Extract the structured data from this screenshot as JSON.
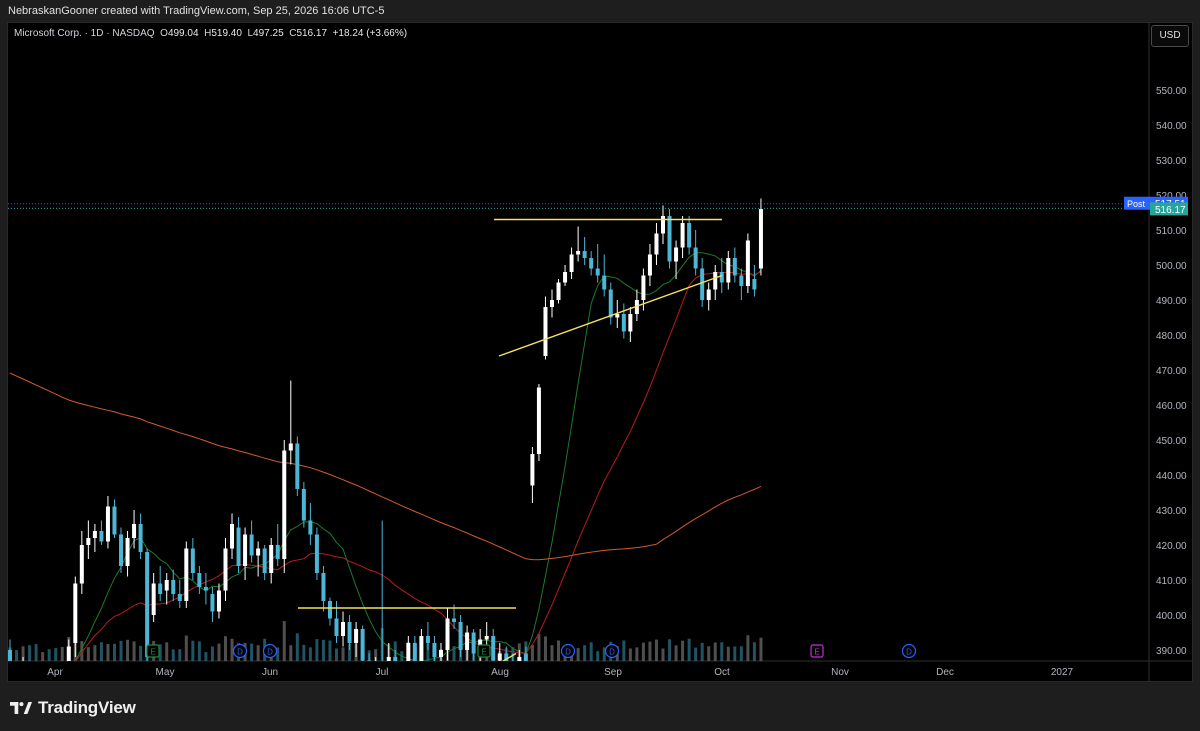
{
  "header": {
    "attribution": "NebraskanGooner created with TradingView.com, Sep 25, 2026 16:06 UTC-5"
  },
  "legend": {
    "symbol": "Microsoft Corp. · 1D · NASDAQ",
    "o_label": "O",
    "o_value": "499.04",
    "h_label": "H",
    "h_value": "519.40",
    "l_label": "L",
    "l_value": "497.25",
    "c_label": "C",
    "c_value": "516.17",
    "change": "+18.24 (+3.66%)"
  },
  "currency_button": "USD",
  "footer": {
    "brand": "TradingView"
  },
  "colors": {
    "up": "#ffffff",
    "down": "#4db6d6",
    "sma_short": "#1b7a2e",
    "sma_mid": "#b71c1c",
    "sma_long": "#d25b2c",
    "trendline": "#f5e15a",
    "post_badge": "#2962ff",
    "last_badge": "#26a69a"
  },
  "chart_data": {
    "type": "candlestick",
    "y_axis": {
      "ylim": [
        381,
        560
      ],
      "ticks": [
        "550.00",
        "540.00",
        "530.00",
        "520.00",
        "510.00",
        "500.00",
        "490.00",
        "480.00",
        "470.00",
        "460.00",
        "450.00",
        "440.00",
        "430.00",
        "420.00",
        "410.00",
        "400.00",
        "390.00"
      ]
    },
    "x_axis": {
      "ticks": [
        "Apr",
        "May",
        "Jun",
        "Jul",
        "Aug",
        "Sep",
        "Oct",
        "Nov",
        "Dec",
        "2027"
      ]
    },
    "price_badges": [
      {
        "label": "Post",
        "value": "517.51"
      },
      {
        "label": "",
        "value": "516.17"
      }
    ],
    "event_markers": [
      {
        "type": "E",
        "near": "May"
      },
      {
        "type": "D",
        "near": "May"
      },
      {
        "type": "D",
        "near": "Jun"
      },
      {
        "type": "E",
        "near": "Aug"
      },
      {
        "type": "D",
        "near": "Aug"
      },
      {
        "type": "D",
        "near": "Sep"
      },
      {
        "type": "E",
        "near": "Nov"
      },
      {
        "type": "D",
        "near": "Nov"
      }
    ],
    "ohlc": [
      [
        390,
        393,
        382,
        384
      ],
      [
        384,
        386,
        381,
        383
      ],
      [
        383,
        388,
        381,
        386
      ],
      [
        386,
        387,
        383,
        384
      ],
      [
        384,
        385,
        381,
        383
      ],
      [
        384,
        386,
        382,
        385
      ],
      [
        385,
        386,
        382,
        383
      ],
      [
        383,
        384,
        381,
        382
      ],
      [
        382,
        383,
        381,
        382
      ],
      [
        382,
        393,
        381,
        391
      ],
      [
        392,
        411,
        388,
        409
      ],
      [
        409,
        424,
        406,
        420
      ],
      [
        420,
        427,
        416,
        422
      ],
      [
        422,
        426,
        418,
        424
      ],
      [
        424,
        427,
        420,
        421
      ],
      [
        421,
        434,
        419,
        431
      ],
      [
        431,
        433,
        422,
        423
      ],
      [
        423,
        425,
        412,
        414
      ],
      [
        414,
        424,
        411,
        422
      ],
      [
        422,
        430,
        419,
        426
      ],
      [
        426,
        429,
        416,
        418
      ],
      [
        418,
        419,
        385,
        388
      ],
      [
        400,
        412,
        398,
        409
      ],
      [
        409,
        414,
        404,
        406
      ],
      [
        407,
        412,
        403,
        410
      ],
      [
        410,
        413,
        404,
        406
      ],
      [
        406,
        410,
        402,
        404
      ],
      [
        404,
        421,
        402,
        419
      ],
      [
        419,
        422,
        410,
        412
      ],
      [
        412,
        414,
        406,
        408
      ],
      [
        408,
        412,
        403,
        407
      ],
      [
        406,
        408,
        398,
        401
      ],
      [
        401,
        409,
        399,
        407
      ],
      [
        407,
        422,
        404,
        419
      ],
      [
        419,
        429,
        416,
        426
      ],
      [
        425,
        428,
        412,
        414
      ],
      [
        414,
        425,
        410,
        423
      ],
      [
        423,
        427,
        415,
        417
      ],
      [
        417,
        421,
        411,
        419
      ],
      [
        419,
        420,
        410,
        412
      ],
      [
        412,
        422,
        409,
        420
      ],
      [
        420,
        426,
        414,
        416
      ],
      [
        416,
        450,
        412,
        447
      ],
      [
        447,
        467,
        443,
        449
      ],
      [
        449,
        451,
        434,
        436
      ],
      [
        436,
        438,
        425,
        427
      ],
      [
        427,
        432,
        420,
        423
      ],
      [
        423,
        425,
        410,
        412
      ],
      [
        412,
        414,
        401,
        404
      ],
      [
        404,
        405,
        397,
        399
      ],
      [
        399,
        404,
        392,
        394
      ],
      [
        394,
        401,
        391,
        398
      ],
      [
        398,
        400,
        390,
        392
      ],
      [
        392,
        398,
        388,
        396
      ],
      [
        396,
        397,
        385,
        387
      ],
      [
        387,
        389,
        381,
        384
      ],
      [
        384,
        388,
        382,
        386
      ],
      [
        386,
        427,
        383,
        385
      ],
      [
        385,
        392,
        381,
        388
      ],
      [
        388,
        390,
        382,
        384
      ],
      [
        384,
        386,
        381,
        382
      ],
      [
        382,
        394,
        381,
        392
      ],
      [
        392,
        394,
        383,
        385
      ],
      [
        385,
        396,
        382,
        394
      ],
      [
        394,
        398,
        390,
        392
      ],
      [
        392,
        394,
        386,
        388
      ],
      [
        388,
        392,
        384,
        390
      ],
      [
        390,
        402,
        387,
        399
      ],
      [
        399,
        403,
        396,
        398
      ],
      [
        398,
        400,
        388,
        390
      ],
      [
        390,
        397,
        387,
        395
      ],
      [
        395,
        396,
        387,
        389
      ],
      [
        389,
        396,
        386,
        393
      ],
      [
        393,
        398,
        390,
        394
      ],
      [
        394,
        396,
        385,
        387
      ],
      [
        387,
        392,
        383,
        389
      ],
      [
        389,
        391,
        384,
        386
      ],
      [
        386,
        389,
        382,
        384
      ],
      [
        384,
        390,
        382,
        388
      ],
      [
        389,
        391,
        383,
        385
      ],
      [
        437,
        448,
        432,
        446
      ],
      [
        446,
        466,
        444,
        465
      ],
      [
        474,
        491,
        473,
        488
      ],
      [
        488,
        493,
        485,
        490
      ],
      [
        490,
        496,
        489,
        495
      ],
      [
        495,
        500,
        494,
        498
      ],
      [
        498,
        505,
        496,
        503
      ],
      [
        503,
        511,
        501,
        504
      ],
      [
        504,
        508,
        500,
        502
      ],
      [
        502,
        504,
        497,
        499
      ],
      [
        499,
        506,
        495,
        497
      ],
      [
        497,
        503,
        491,
        493
      ],
      [
        493,
        495,
        483,
        485
      ],
      [
        485,
        490,
        482,
        486
      ],
      [
        486,
        489,
        479,
        481
      ],
      [
        481,
        488,
        478,
        486
      ],
      [
        486,
        493,
        484,
        490
      ],
      [
        490,
        499,
        487,
        497
      ],
      [
        497,
        506,
        494,
        503
      ],
      [
        503,
        512,
        500,
        509
      ],
      [
        509,
        517,
        506,
        514
      ],
      [
        514,
        516,
        499,
        501
      ],
      [
        501,
        507,
        496,
        505
      ],
      [
        505,
        514,
        502,
        512
      ],
      [
        512,
        514,
        503,
        505
      ],
      [
        505,
        510,
        497,
        499
      ],
      [
        499,
        502,
        488,
        490
      ],
      [
        490,
        495,
        487,
        493
      ],
      [
        493,
        500,
        490,
        498
      ],
      [
        498,
        502,
        492,
        495
      ],
      [
        495,
        504,
        493,
        502
      ],
      [
        502,
        505,
        495,
        497
      ],
      [
        497,
        499,
        490,
        494
      ],
      [
        494,
        509,
        492,
        507
      ],
      [
        496,
        500,
        491,
        493
      ],
      [
        499,
        519,
        497,
        516
      ]
    ]
  }
}
